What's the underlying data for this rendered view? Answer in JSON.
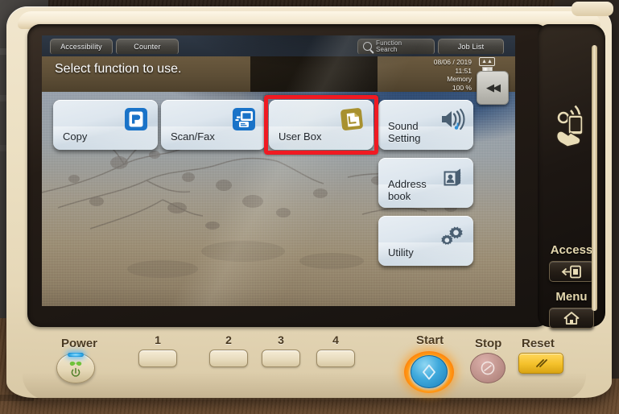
{
  "screen": {
    "tabs": [
      {
        "id": "accessibility",
        "label": "Accessibility"
      },
      {
        "id": "counter",
        "label": "Counter"
      }
    ],
    "function_search": {
      "line1": "Function",
      "line2": "Search",
      "icon": "search-icon"
    },
    "job_list": {
      "label": "Job List"
    },
    "message": "Select function to use.",
    "status": {
      "date": "08/06 / 2019",
      "time": "11:51",
      "memory_label": "Memory",
      "memory_value": "100 %",
      "toner_icon": "toner-cartridge-icon"
    },
    "collapse_button": {
      "label": "◀◀",
      "icon": "collapse-left-icon"
    },
    "functions": [
      {
        "id": "copy",
        "label": "Copy",
        "icon": "copy-icon",
        "icon_color": "#1a73c8",
        "selected": false
      },
      {
        "id": "scanfax",
        "label": "Scan/Fax",
        "icon": "scan-fax-icon",
        "icon_color": "#1a73c8",
        "selected": false
      },
      {
        "id": "userbox",
        "label": "User Box",
        "icon": "user-box-icon",
        "icon_color": "#a8912f",
        "selected": true
      },
      {
        "id": "sound",
        "label": "Sound\nSetting",
        "icon": "speaker-icon",
        "icon_color": "#4a5f72",
        "selected": false
      },
      {
        "id": "address",
        "label": "Address\nbook",
        "icon": "address-book-icon",
        "icon_color": "#4a5f72",
        "selected": false
      },
      {
        "id": "utility",
        "label": "Utility",
        "icon": "gears-icon",
        "icon_color": "#4a5f72",
        "selected": false
      }
    ],
    "selection_color": "#f01a22"
  },
  "side_panel": {
    "nfc_icon": "nfc-touch-icon",
    "access": {
      "label": "Access",
      "icon": "access-card-icon"
    },
    "menu": {
      "label": "Menu",
      "icon": "home-icon"
    }
  },
  "hardware": {
    "power": {
      "label": "Power",
      "icon": "power-icon",
      "led": "on",
      "eco_icon": "eco-leaf-icon"
    },
    "number_keys": [
      {
        "label": "1"
      },
      {
        "label": "2"
      },
      {
        "label": "3"
      },
      {
        "label": "4"
      }
    ],
    "start": {
      "label": "Start",
      "icon": "start-diamond-icon",
      "ring": "#ff8a10"
    },
    "stop": {
      "label": "Stop",
      "icon": "stop-octagon-icon"
    },
    "reset": {
      "label": "Reset",
      "icon": "reset-slashes-icon"
    }
  }
}
